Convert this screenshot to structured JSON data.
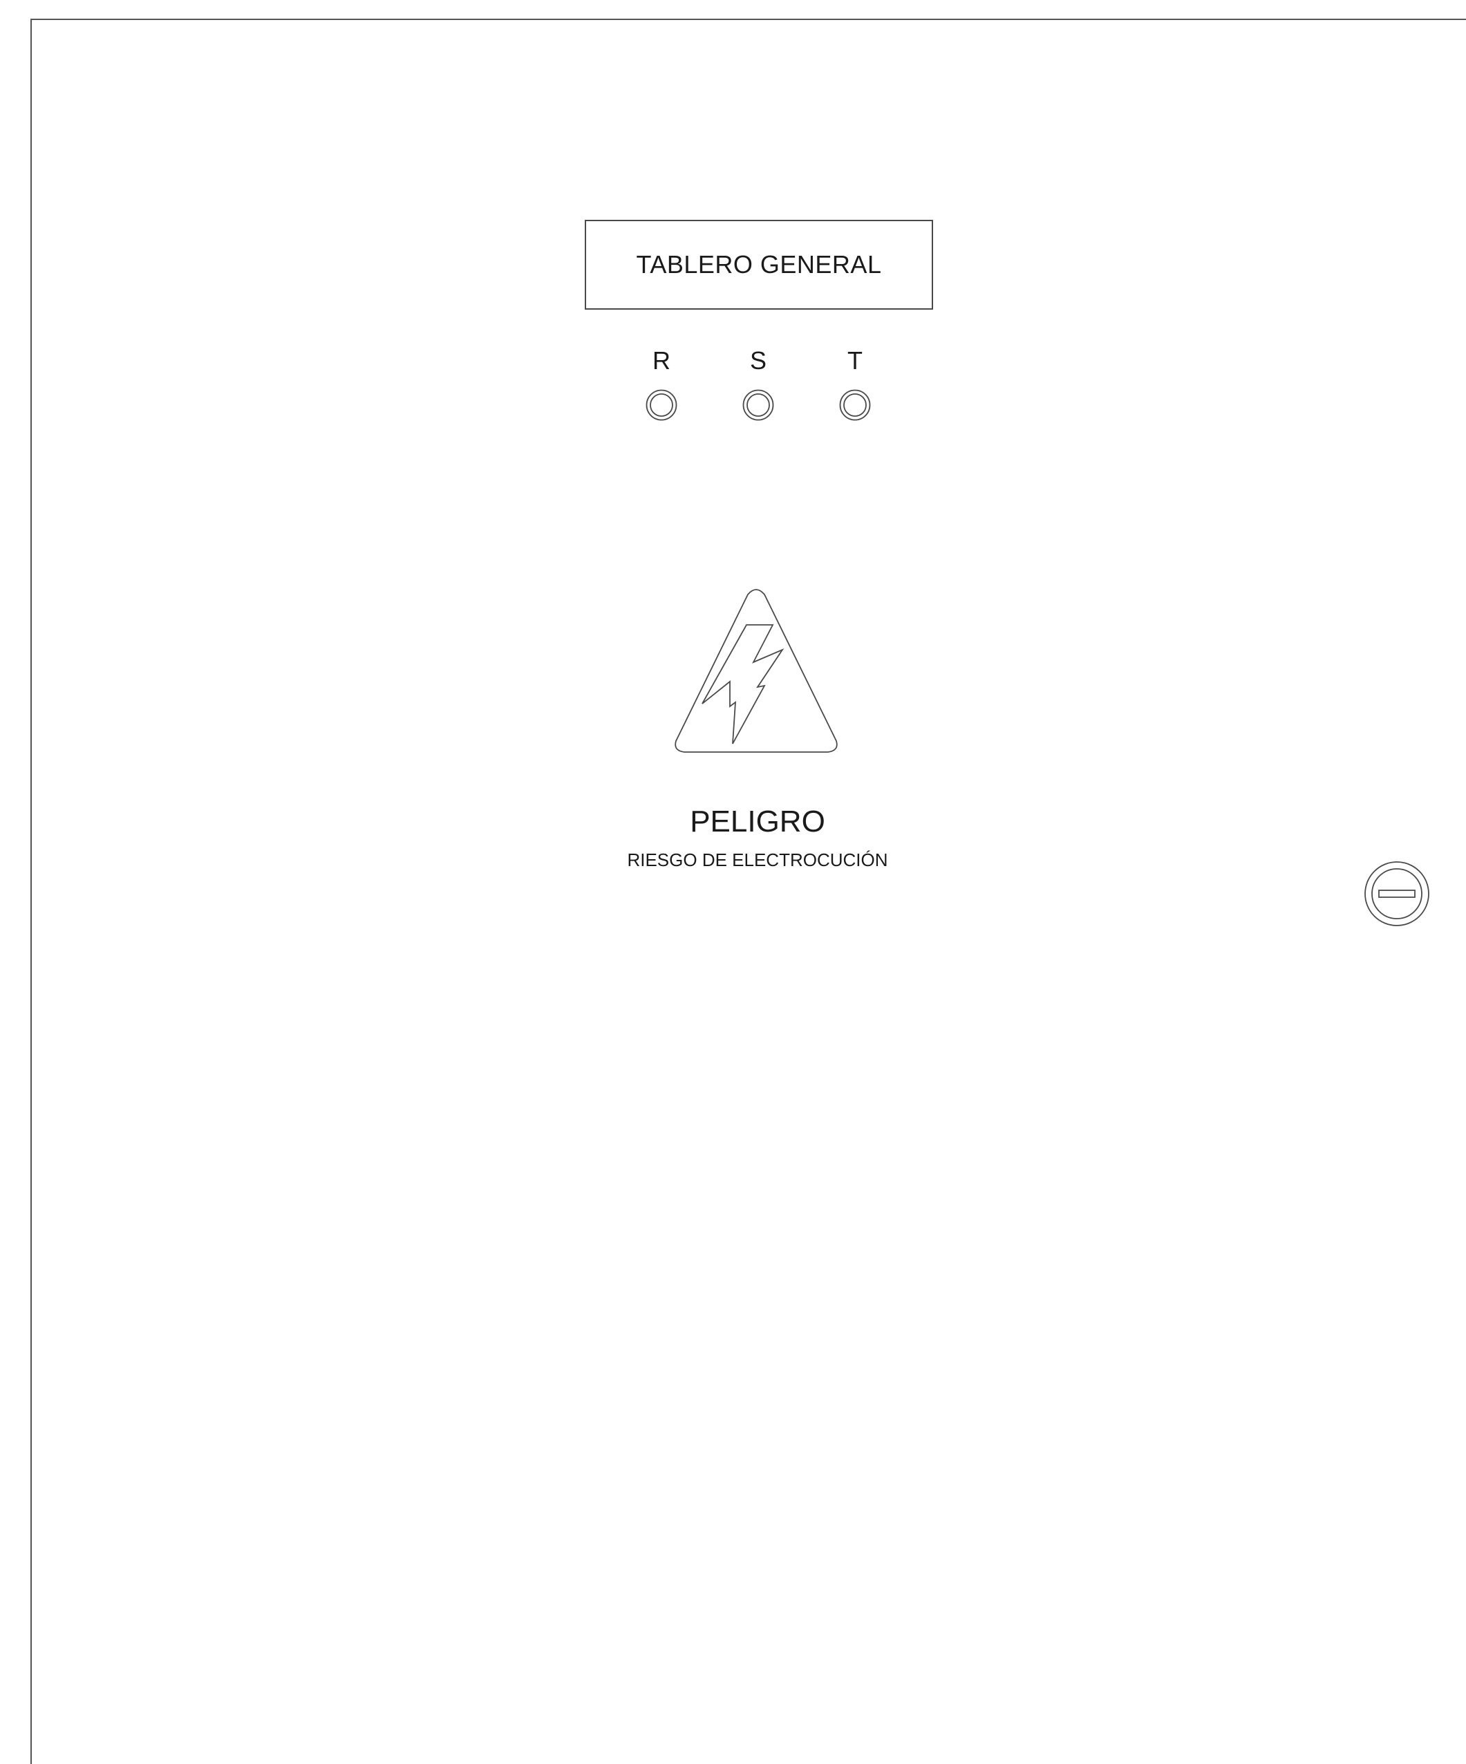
{
  "panel": {
    "nameplate": "TABLERO GENERAL",
    "phases": [
      {
        "label": "R",
        "icon": "pilot-lamp-icon"
      },
      {
        "label": "S",
        "icon": "pilot-lamp-icon"
      },
      {
        "label": "T",
        "icon": "pilot-lamp-icon"
      }
    ],
    "warning": {
      "icon": "electric-hazard-icon",
      "title": "PELIGRO",
      "subtitle": "RIESGO DE ELECTROCUCIÓN"
    },
    "lock_icon": "door-lock-icon"
  },
  "colors": {
    "background": "#ffffff",
    "line": "#4a4a4a",
    "text": "#1a1a1a"
  }
}
